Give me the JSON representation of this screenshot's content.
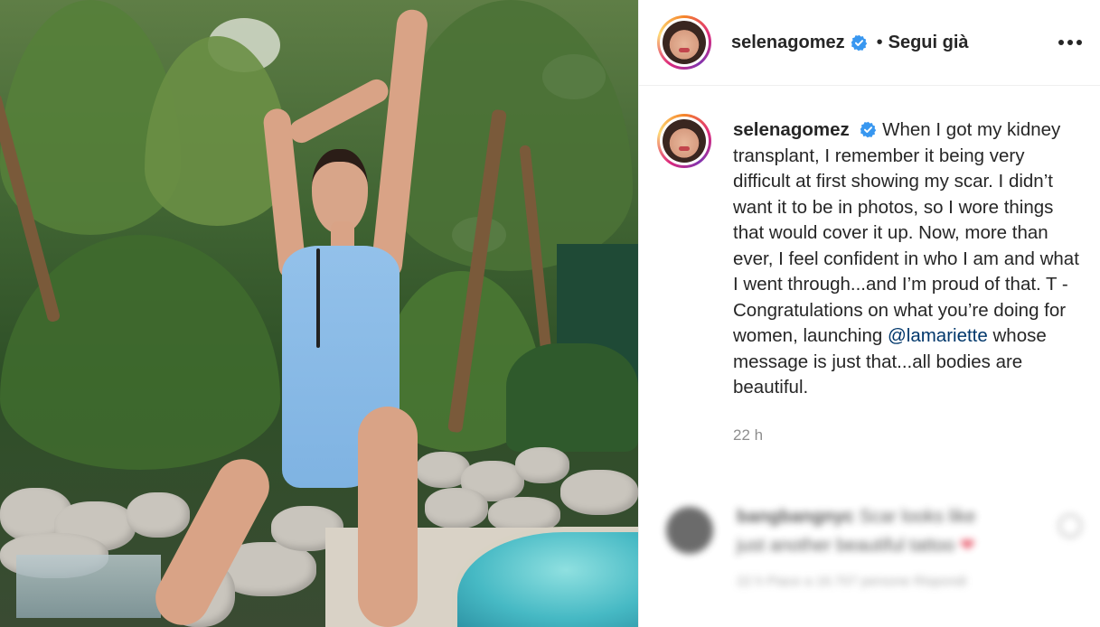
{
  "header": {
    "username": "selenagomez",
    "separator": "•",
    "follow_label": "Segui già"
  },
  "caption": {
    "username": "selenagomez",
    "text_before_mention": "When I got my kidney transplant, I remember it being very difficult at first showing my scar. I didn’t want it to be in photos, so I wore things that would cover it up. Now, more than ever, I feel confident in who I am and what I went through...and I’m proud of that. T - Congratulations on what you’re doing for women, launching",
    "mention": "@lamariette",
    "text_after_mention": "whose message is just that...all bodies are beautiful.",
    "time": "22 h"
  },
  "comment": {
    "username": "bangbangnyc",
    "text_line1": "Scar looks like",
    "text_line2": "just another beautiful tattoo",
    "heart": "❤",
    "meta": "22 h    Piace a 16.707 persone    Rispondi"
  },
  "colors": {
    "verified": "#3897f0",
    "mention": "#00376b",
    "text": "#262626",
    "muted": "#8e8e8e"
  },
  "icons": [
    "verified-badge-icon",
    "more-options-icon",
    "like-heart-icon"
  ]
}
